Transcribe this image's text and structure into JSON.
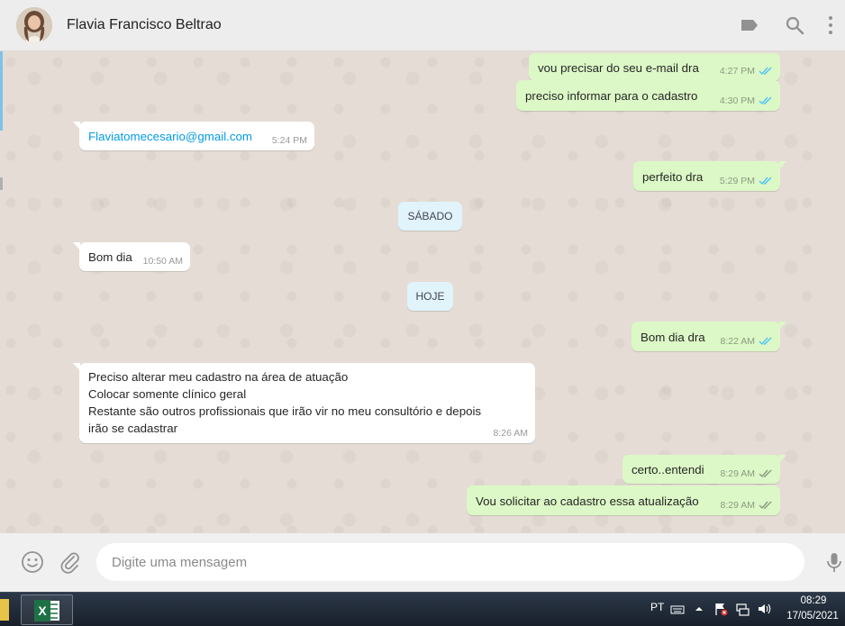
{
  "header": {
    "contact_name": "Flavia Francisco Beltrao",
    "icons": [
      "label-icon",
      "search-icon",
      "menu-icon"
    ]
  },
  "messages": [
    {
      "dir": "out",
      "text": "vou precisar do seu e-mail dra",
      "time": "4:27 PM",
      "status": "read"
    },
    {
      "dir": "out",
      "text": "preciso informar para o cadastro",
      "time": "4:30 PM",
      "status": "read"
    },
    {
      "dir": "in",
      "text": "Flaviatomecesario@gmail.com",
      "time": "5:24 PM",
      "link": true
    },
    {
      "dir": "out",
      "text": "perfeito dra",
      "time": "5:29 PM",
      "status": "read"
    },
    {
      "dir": "in",
      "text": "Bom dia",
      "time": "10:50 AM"
    },
    {
      "dir": "out",
      "text": "Bom dia dra",
      "time": "8:22 AM",
      "status": "read"
    },
    {
      "dir": "in",
      "lines": [
        "Preciso alterar meu cadastro na área de atuação",
        "Colocar somente clínico geral",
        "Restante são outros profissionais que irão vir no meu consultório e depois",
        "irão se cadastrar"
      ],
      "time": "8:26 AM"
    },
    {
      "dir": "out",
      "text": "certo..entendi",
      "time": "8:29 AM",
      "status": "delivered"
    },
    {
      "dir": "out",
      "text": "Vou solicitar ao cadastro essa atualização",
      "time": "8:29 AM",
      "status": "delivered"
    }
  ],
  "day_labels": [
    "SÁBADO",
    "HOJE"
  ],
  "footer": {
    "placeholder": "Digite uma mensagem",
    "icons": [
      "emoji-icon",
      "attach-icon",
      "mic-icon"
    ]
  },
  "taskbar": {
    "language": "PT",
    "time": "08:29",
    "date": "17/05/2021"
  },
  "colors": {
    "outgoing_bubble": "#dcf8c6",
    "incoming_bubble": "#ffffff",
    "chat_background": "#e5ddd5",
    "read_tick": "#4fc3f7",
    "link": "#039be5"
  }
}
